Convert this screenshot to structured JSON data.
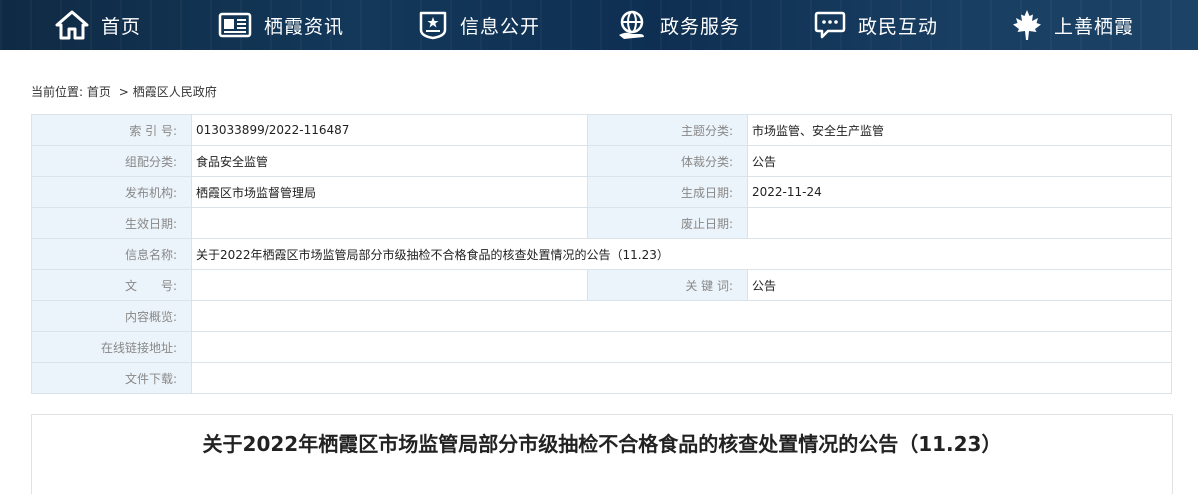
{
  "nav": {
    "items": [
      {
        "label": "首页",
        "icon": "home-icon"
      },
      {
        "label": "栖霞资讯",
        "icon": "news-icon"
      },
      {
        "label": "信息公开",
        "icon": "badge-icon"
      },
      {
        "label": "政务服务",
        "icon": "globe-hand-icon"
      },
      {
        "label": "政民互动",
        "icon": "chat-icon"
      },
      {
        "label": "上善栖霞",
        "icon": "maple-leaf-icon"
      }
    ]
  },
  "breadcrumb": {
    "prefix": "当前位置:",
    "items": [
      "首页",
      "栖霞区人民政府"
    ],
    "separator": ">"
  },
  "info": {
    "index_label": "索 引 号:",
    "index_value": "013033899/2022-116487",
    "topic_label": "主题分类:",
    "topic_value": "市场监管、安全生产监管",
    "group_label": "组配分类:",
    "group_value": "食品安全监管",
    "genre_label": "体裁分类:",
    "genre_value": "公告",
    "publisher_label": "发布机构:",
    "publisher_value": "栖霞区市场监督管理局",
    "created_label": "生成日期:",
    "created_value": "2022-11-24",
    "effective_label": "生效日期:",
    "effective_value": "",
    "abolish_label": "废止日期:",
    "abolish_value": "",
    "name_label": "信息名称:",
    "name_value": "关于2022年栖霞区市场监管局部分市级抽检不合格食品的核查处置情况的公告（11.23）",
    "docno_label": "文　　号:",
    "docno_value": "",
    "keywords_label": "关 键 词:",
    "keywords_value": "公告",
    "summary_label": "内容概览:",
    "summary_value": "",
    "link_label": "在线链接地址:",
    "link_value": "",
    "download_label": "文件下载:",
    "download_value": ""
  },
  "article": {
    "title": "关于2022年栖霞区市场监管局部分市级抽检不合格食品的核查处置情况的公告（11.23）"
  },
  "colors": {
    "nav_bg": "#13385a",
    "label_cell_bg": "#ecf4fb",
    "border": "#dbe3ea"
  }
}
